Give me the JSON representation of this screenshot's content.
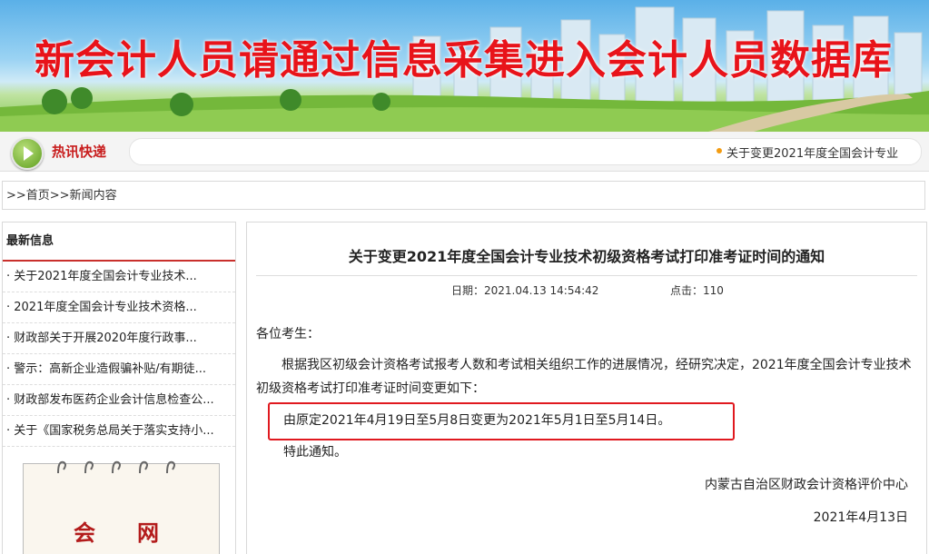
{
  "banner": {
    "title": "新会计人员请通过信息采集进入会计人员数据库"
  },
  "ticker": {
    "label": "热讯快递",
    "text": "关于变更2021年度全国会计专业"
  },
  "breadcrumb": ">>首页>>新闻内容",
  "sidebar": {
    "title": "最新信息",
    "items": [
      "· 关于2021年度全国会计专业技术...",
      "· 2021年度全国会计专业技术资格...",
      "· 财政部关于开展2020年度行政事...",
      "· 警示：高新企业造假骗补贴/有期徒...",
      "· 财政部发布医药企业会计信息检查公...",
      "· 关于《国家税务总局关于落实支持小..."
    ],
    "image_text": [
      "会",
      "网"
    ]
  },
  "article": {
    "title": "关于变更2021年度全国会计专业技术初级资格考试打印准考证时间的通知",
    "date": "日期：2021.04.13 14:54:42",
    "hits": "点击：110",
    "greeting": "各位考生：",
    "body": "根据我区初级会计资格考试报考人数和考试相关组织工作的进展情况，经研究决定，2021年度全国会计专业技术初级资格考试打印准考证时间变更如下：",
    "highlight": "由原定2021年4月19日至5月8日变更为2021年5月1日至5月14日。",
    "closing": "特此通知。",
    "org": "内蒙古自治区财政会计资格评价中心",
    "sign_date": "2021年4月13日"
  },
  "colors": {
    "accent_red": "#e0191f",
    "banner_red": "#e8131a",
    "sidebar_rule": "#c9302c"
  }
}
